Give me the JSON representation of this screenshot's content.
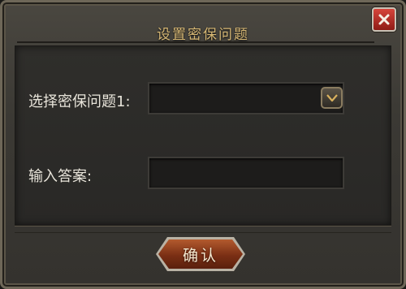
{
  "dialog": {
    "title": "设置密保问题",
    "close_icon": "close-icon",
    "question_label": "选择密保问题1:",
    "question_value": "",
    "dropdown_icon": "chevron-down-icon",
    "answer_label": "输入答案:",
    "answer_value": "",
    "confirm_label": "确认"
  },
  "colors": {
    "title": "#d6b774",
    "close_button": "#c8372e",
    "confirm_button": "#8a3a17",
    "panel": "#2d2c29"
  }
}
